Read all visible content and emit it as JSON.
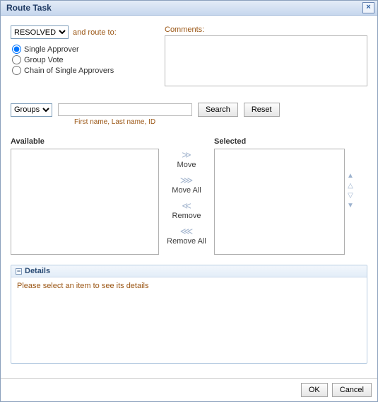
{
  "dialog": {
    "title": "Route Task"
  },
  "status": {
    "selected": "RESOLVED",
    "route_to_label": "and route to:"
  },
  "route_options": {
    "single": "Single Approver",
    "group": "Group Vote",
    "chain": "Chain of Single Approvers"
  },
  "comments": {
    "label": "Comments:",
    "value": ""
  },
  "search": {
    "scope_selected": "Groups",
    "value": "",
    "search_btn": "Search",
    "reset_btn": "Reset",
    "hint": "First name, Last name, ID"
  },
  "picker": {
    "available_label": "Available",
    "selected_label": "Selected",
    "move": "Move",
    "move_all": "Move All",
    "remove": "Remove",
    "remove_all": "Remove All"
  },
  "details": {
    "header": "Details",
    "empty_msg": "Please select an item to see its details"
  },
  "footer": {
    "ok": "OK",
    "cancel": "Cancel"
  }
}
